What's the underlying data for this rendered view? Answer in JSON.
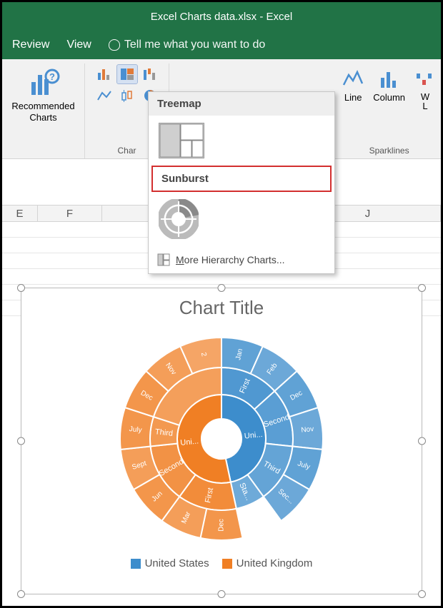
{
  "window": {
    "title": "Excel Charts data.xlsx - Excel"
  },
  "tabs": {
    "review": "Review",
    "view": "View",
    "tellme": "Tell me what you want to do"
  },
  "ribbon": {
    "recommended_label": "Recommended\nCharts",
    "charts_group": "Char",
    "sparklines_group": "Sparklines",
    "sparkline_line": "Line",
    "sparkline_column": "Column",
    "sparkline_wl": "W\nL"
  },
  "dropdown": {
    "treemap": "Treemap",
    "sunburst": "Sunburst",
    "more_prefix": "M",
    "more_rest": "ore Hierarchy Charts..."
  },
  "columns": [
    "E",
    "F",
    "",
    "",
    "",
    "J"
  ],
  "chart": {
    "title": "Chart Title",
    "legend_us": "United States",
    "legend_uk": "United Kingdom"
  },
  "chart_data": {
    "type": "sunburst",
    "title": "Chart Title",
    "legend": [
      "United States",
      "United Kingdom"
    ],
    "colors": {
      "United States": "#3d8dcc",
      "United Kingdom": "#f07f24"
    },
    "hierarchy": [
      {
        "name": "United States",
        "children": [
          {
            "name": "First",
            "children": [
              {
                "name": "Jan"
              },
              {
                "name": "Feb"
              }
            ]
          },
          {
            "name": "Second",
            "children": [
              {
                "name": "Dec"
              },
              {
                "name": "Nov"
              }
            ]
          },
          {
            "name": "Third",
            "children": [
              {
                "name": "July"
              },
              {
                "name": "Sec..."
              }
            ]
          },
          {
            "name": "Sta..."
          }
        ]
      },
      {
        "name": "United Kingdom",
        "children": [
          {
            "name": "First",
            "children": [
              {
                "name": "Dec"
              },
              {
                "name": "Mar"
              }
            ]
          },
          {
            "name": "Second",
            "children": [
              {
                "name": "Jun"
              },
              {
                "name": "Sept"
              }
            ]
          },
          {
            "name": "Third",
            "children": [
              {
                "name": "July"
              }
            ]
          },
          {
            "name": "",
            "children": [
              {
                "name": "Dec"
              },
              {
                "name": "Nov"
              },
              {
                "name": "2"
              }
            ]
          }
        ]
      }
    ]
  }
}
